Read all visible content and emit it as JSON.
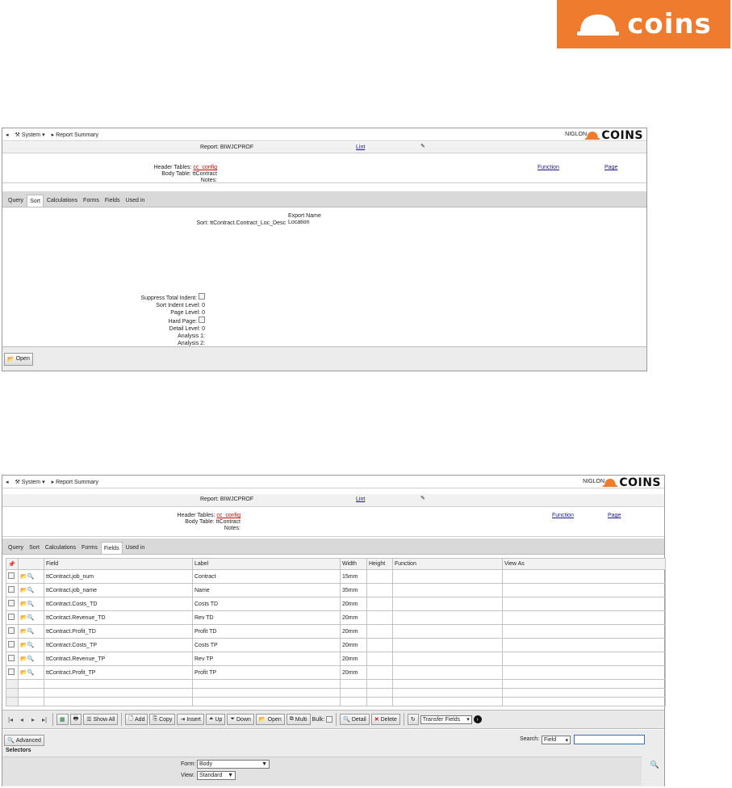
{
  "brand": {
    "logo_text": "coins",
    "color": "#ee7b2e"
  },
  "app": {
    "system_label": "System",
    "breadcrumb": "Report Summary",
    "user": "NIGLON",
    "mini_logo_text": "COINS"
  },
  "report": {
    "report_label": "Report: BIWJCPROF",
    "lint_link": "Lint",
    "header_tables_label": "Header Tables:",
    "header_tables_value": "cc_config",
    "body_table_label": "Body Table:",
    "body_table_value": "ttContract",
    "notes_label": "Notes:",
    "function_link": "Function",
    "page_link": "Page"
  },
  "tabs": [
    "Query",
    "Sort",
    "Calculations",
    "Forms",
    "Fields",
    "Used in"
  ],
  "sort_panel": {
    "sort_label": "Sort:",
    "sort_value": "ttContract.Contract_Loc_Desc",
    "export_name": "Export Name",
    "location": "Location",
    "suppress_total_indent": "Suppress Total Indent:",
    "sort_indent_level": "Sort Indent Level: 0",
    "page_level": "Page Level: 0",
    "hard_page": "Hard Page:",
    "detail_level": "Detail Level: 0",
    "analysis1": "Analysis 1:",
    "analysis2": "Analysis 2:",
    "open_button": "Open"
  },
  "fields_panel": {
    "columns": [
      "Field",
      "Label",
      "Width",
      "Height",
      "Function",
      "View As"
    ],
    "rows": [
      {
        "field": "ttContract.job_num",
        "label": "Contract",
        "width": "15mm"
      },
      {
        "field": "ttContract.job_name",
        "label": "Name",
        "width": "35mm"
      },
      {
        "field": "ttContract.Costs_TD",
        "label": "Costs TD",
        "width": "20mm"
      },
      {
        "field": "ttContract.Revenue_TD",
        "label": "Rev TD",
        "width": "20mm"
      },
      {
        "field": "ttContract.Profit_TD",
        "label": "Profit TD",
        "width": "20mm"
      },
      {
        "field": "ttContract.Costs_TP",
        "label": "Costs TP",
        "width": "20mm"
      },
      {
        "field": "ttContract.Revenue_TP",
        "label": "Rev TP",
        "width": "20mm"
      },
      {
        "field": "ttContract.Profit_TP",
        "label": "Profit TP",
        "width": "20mm"
      }
    ],
    "toolbar": {
      "show_all": "Show All",
      "add": "Add",
      "copy": "Copy",
      "insert": "Insert",
      "up": "Up",
      "down": "Down",
      "open": "Open",
      "multi": "Multi",
      "bulk": "Bulk:",
      "detail": "Detail",
      "delete": "Delete",
      "transfer_fields": "Transfer Fields"
    },
    "advanced_button": "Advanced",
    "search_label": "Search:",
    "search_option": "Field",
    "selectors_label": "Selectors",
    "form_label": "Form:",
    "form_value": "Body",
    "view_label": "View:",
    "view_value": "Standard"
  }
}
